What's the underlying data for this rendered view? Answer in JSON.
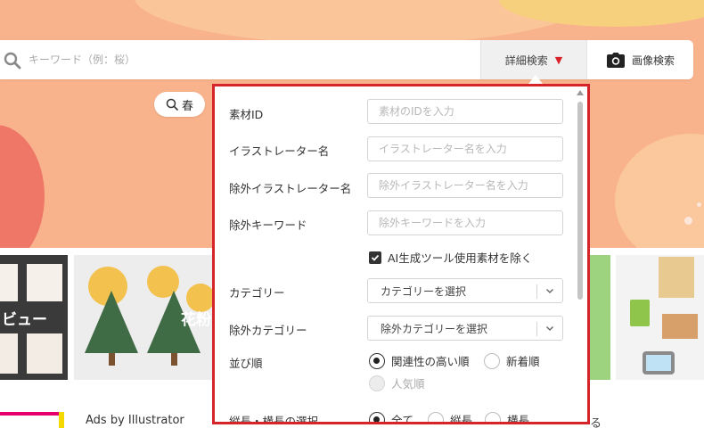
{
  "search": {
    "placeholder": "キーワード（例：桜）",
    "detail_button": "詳細検索",
    "image_search_button": "画像検索"
  },
  "tag_pill": {
    "label": "春"
  },
  "cards": [
    {
      "label": "ビュー"
    },
    {
      "label": "花粉"
    }
  ],
  "ads": {
    "text": "Ads by Illustrator"
  },
  "stray_text": "る",
  "panel": {
    "material_id": {
      "label": "素材ID",
      "placeholder": "素材のIDを入力"
    },
    "illustrator_name": {
      "label": "イラストレーター名",
      "placeholder": "イラストレーター名を入力"
    },
    "exclude_illustrator": {
      "label": "除外イラストレーター名",
      "placeholder": "除外イラストレーター名を入力"
    },
    "exclude_keyword": {
      "label": "除外キーワード",
      "placeholder": "除外キーワードを入力"
    },
    "ai_checkbox": {
      "label": "AI生成ツール使用素材を除く",
      "checked": true
    },
    "category": {
      "label": "カテゴリー",
      "selected": "カテゴリーを選択"
    },
    "exclude_category": {
      "label": "除外カテゴリー",
      "selected": "除外カテゴリーを選択"
    },
    "sort": {
      "label": "並び順",
      "options": [
        "関連性の高い順",
        "新着順",
        "人気順"
      ],
      "selected": "関連性の高い順",
      "disabled": [
        "人気順"
      ]
    },
    "orientation": {
      "label": "縦長・横長の選択",
      "options": [
        "全て",
        "縦長",
        "横長"
      ],
      "selected": "全て"
    }
  },
  "colors": {
    "hero_bg": "#f9b38c",
    "panel_border": "#d6242b",
    "dropdown_triangle": "#d8212a"
  },
  "icons": [
    "search-icon",
    "triangle-down-icon",
    "camera-icon",
    "chevron-down-icon",
    "check-icon"
  ]
}
